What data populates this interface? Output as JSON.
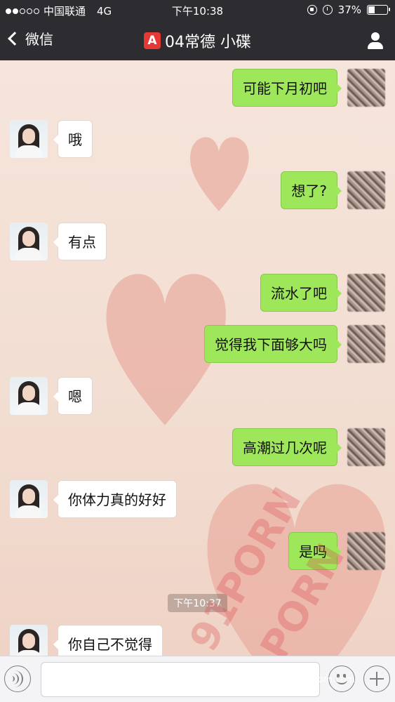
{
  "status_bar": {
    "carrier": "中国联通",
    "network": "4G",
    "time": "下午10:38",
    "battery": "37%",
    "battery_fraction": 0.37
  },
  "nav": {
    "back_label": "微信",
    "badge": "A",
    "title": "04常德 小碟"
  },
  "messages": [
    {
      "side": "out",
      "text": "可能下月初吧"
    },
    {
      "side": "in",
      "text": "哦"
    },
    {
      "side": "out",
      "text": "想了?"
    },
    {
      "side": "in",
      "text": "有点"
    },
    {
      "side": "out",
      "text": "流水了吧"
    },
    {
      "side": "out",
      "text": "觉得我下面够大吗"
    },
    {
      "side": "in",
      "text": "嗯"
    },
    {
      "side": "out",
      "text": "高潮过几次呢"
    },
    {
      "side": "in",
      "text": "你体力真的好好"
    },
    {
      "side": "out",
      "text": "是吗"
    },
    {
      "side": "in",
      "text": "你自己不觉得"
    }
  ],
  "timestamp": "下午10:37",
  "watermark": "91PORN",
  "site_mark": "91porn.com",
  "colors": {
    "outgoing_bubble": "#9ee75a",
    "incoming_bubble": "#ffffff",
    "header": "#2d2c31",
    "badge": "#e53935"
  }
}
